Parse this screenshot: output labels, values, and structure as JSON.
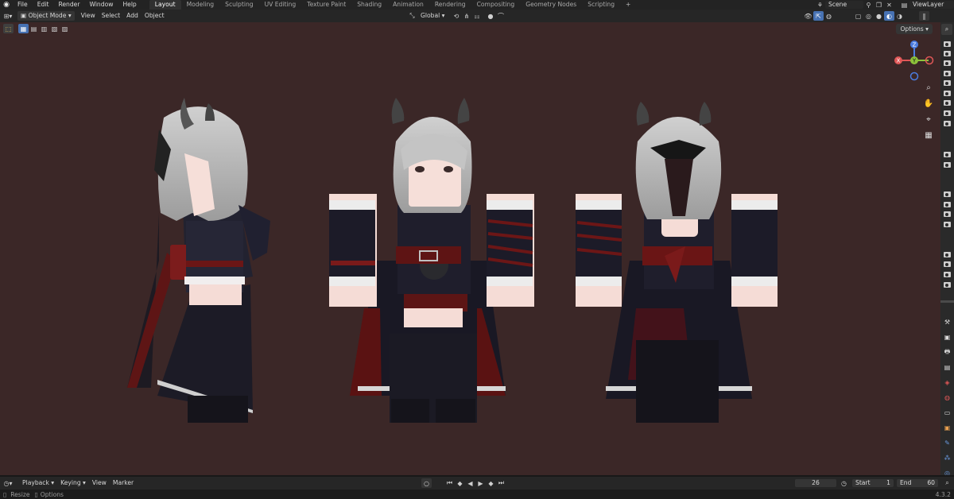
{
  "menu": [
    "File",
    "Edit",
    "Render",
    "Window",
    "Help"
  ],
  "workspaces": [
    "Layout",
    "Modeling",
    "Sculpting",
    "UV Editing",
    "Texture Paint",
    "Shading",
    "Animation",
    "Rendering",
    "Compositing",
    "Geometry Nodes",
    "Scripting"
  ],
  "workspace_add": "+",
  "scene": {
    "name": "Scene",
    "view_layer": "ViewLayer"
  },
  "header": {
    "mode": "Object Mode",
    "view": "View",
    "select": "Select",
    "add": "Add",
    "object": "Object",
    "orientation": "Global"
  },
  "viewport": {
    "options": "Options",
    "background": "#3b2727"
  },
  "gizmo": {
    "z": "Z",
    "x": "X",
    "y": "Y"
  },
  "timeline": {
    "playback": "Playback",
    "keying": "Keying",
    "view": "View",
    "marker": "Marker",
    "current_frame": "26",
    "start_label": "Start",
    "start": "1",
    "end_label": "End",
    "end": "60"
  },
  "status": {
    "resize": "Resize",
    "options": "Options",
    "version": "4.3.2"
  },
  "colors": {
    "accent": "#4772b3",
    "gizmo_x": "#e05757",
    "gizmo_y": "#8dc33b",
    "gizmo_z": "#4b7ce0"
  }
}
